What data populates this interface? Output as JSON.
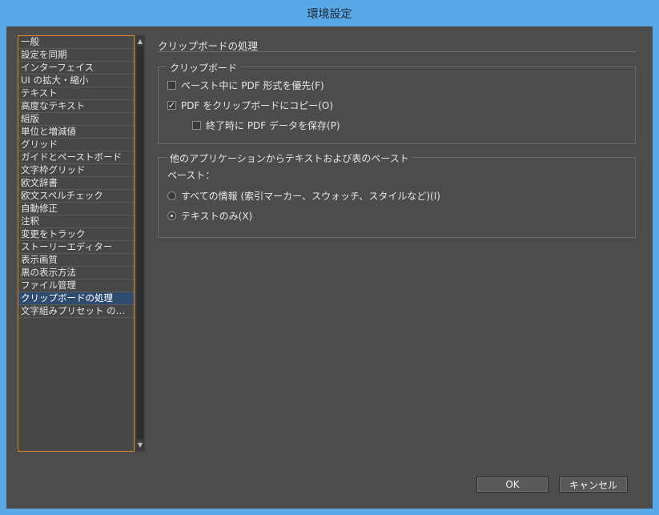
{
  "window": {
    "title": "環境設定"
  },
  "sidebar": {
    "items": [
      {
        "label": "一般",
        "selected": false
      },
      {
        "label": "設定を同期",
        "selected": false
      },
      {
        "label": "インターフェイス",
        "selected": false
      },
      {
        "label": "UI の拡大・縮小",
        "selected": false
      },
      {
        "label": "テキスト",
        "selected": false
      },
      {
        "label": "高度なテキスト",
        "selected": false
      },
      {
        "label": "組版",
        "selected": false
      },
      {
        "label": "単位と増減値",
        "selected": false
      },
      {
        "label": "グリッド",
        "selected": false
      },
      {
        "label": "ガイドとペーストボード",
        "selected": false
      },
      {
        "label": "文字枠グリッド",
        "selected": false
      },
      {
        "label": "欧文辞書",
        "selected": false
      },
      {
        "label": "欧文スペルチェック",
        "selected": false
      },
      {
        "label": "自動修正",
        "selected": false
      },
      {
        "label": "注釈",
        "selected": false
      },
      {
        "label": "変更をトラック",
        "selected": false
      },
      {
        "label": "ストーリーエディター",
        "selected": false
      },
      {
        "label": "表示画質",
        "selected": false
      },
      {
        "label": "黒の表示方法",
        "selected": false
      },
      {
        "label": "ファイル管理",
        "selected": false
      },
      {
        "label": "クリップボードの処理",
        "selected": true
      },
      {
        "label": "文字組みプリセット の…",
        "selected": false
      }
    ]
  },
  "panel": {
    "title": "クリップボードの処理",
    "clipboard_group": {
      "legend": "クリップボード",
      "prefer_pdf": {
        "label": "ペースト中に PDF 形式を優先(F)",
        "checked": false
      },
      "copy_pdf": {
        "label": "PDF をクリップボードにコピー(O)",
        "checked": true
      },
      "preserve_pdf": {
        "label": "終了時に PDF データを保存(P)",
        "checked": false
      }
    },
    "paste_group": {
      "legend": "他のアプリケーションからテキストおよび表のペースト",
      "paste_label": "ペースト：",
      "all_info": {
        "label": "すべての情報 (索引マーカー、スウォッチ、スタイルなど)(I)",
        "selected": false
      },
      "text_only": {
        "label": "テキストのみ(X)",
        "selected": true
      }
    }
  },
  "buttons": {
    "ok": "OK",
    "cancel": "キャンセル"
  },
  "icons": {
    "check": "✓",
    "scroll_up": "▲",
    "scroll_down": "▼"
  }
}
